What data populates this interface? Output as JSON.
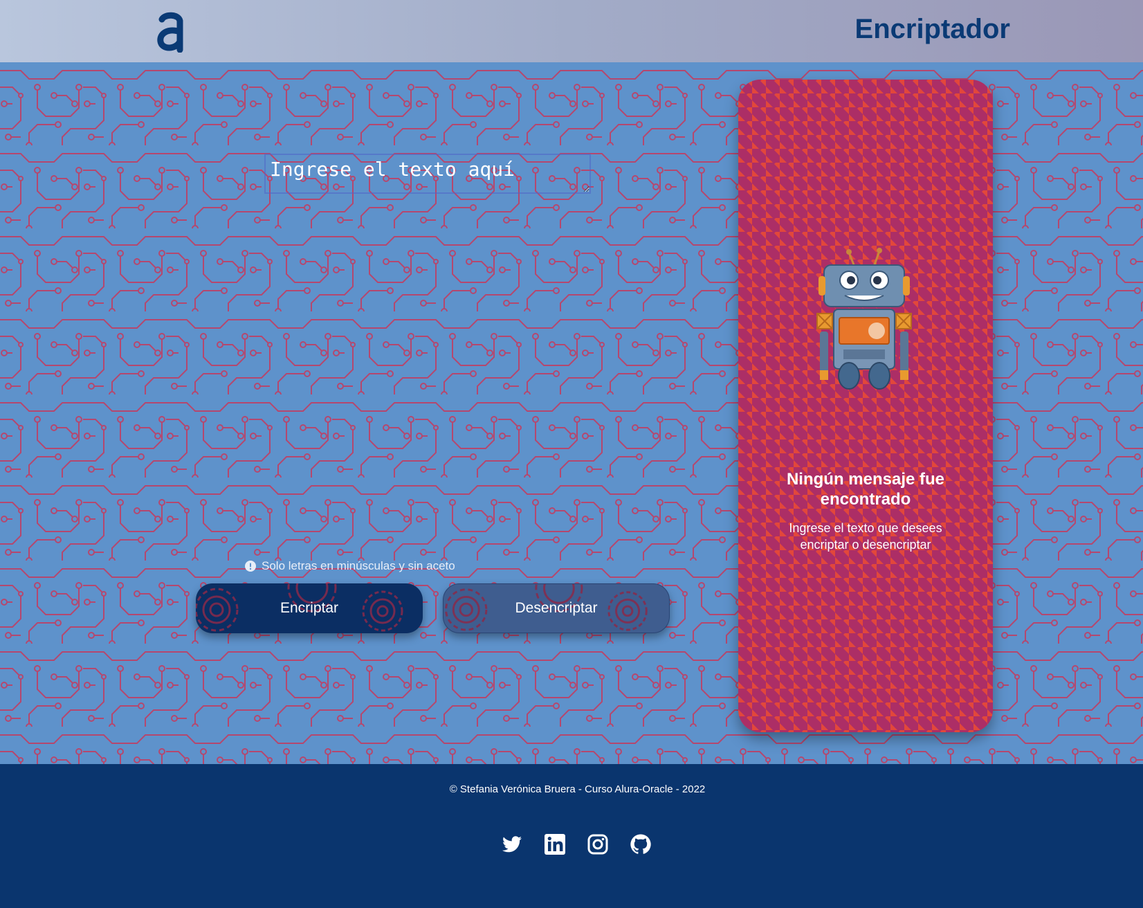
{
  "header": {
    "logo_icon": "alura-a-logo-icon",
    "title": "Encriptador"
  },
  "input": {
    "placeholder": "Ingrese el texto aquí",
    "value": ""
  },
  "hint": {
    "icon": "exclamation-circle-icon",
    "text": "Solo letras en minúsculas y sin aceto"
  },
  "buttons": {
    "encrypt_label": "Encriptar",
    "decrypt_label": "Desencriptar"
  },
  "result": {
    "illustration": "robot-illustration",
    "title": "Ningún mensaje fue encontrado",
    "subtitle": "Ingrese el texto que desees encriptar o desencriptar"
  },
  "footer": {
    "copyright": "© Stefania Verónica Bruera - Curso Alura-Oracle - 2022",
    "socials": [
      "twitter-icon",
      "linkedin-icon",
      "instagram-icon",
      "github-icon"
    ]
  },
  "colors": {
    "header_gradient_start": "#b9c6dd",
    "header_gradient_end": "#9a97b6",
    "title": "#0a3a75",
    "main_bg": "#5e92cb",
    "circuit_lines": "#b5476e",
    "panel_red": "#e2473b",
    "panel_magenta": "#a62b6b",
    "encrypt_button": "#0b2e63",
    "decrypt_button": "#3f5d8f",
    "footer_bg": "#0a356e"
  }
}
